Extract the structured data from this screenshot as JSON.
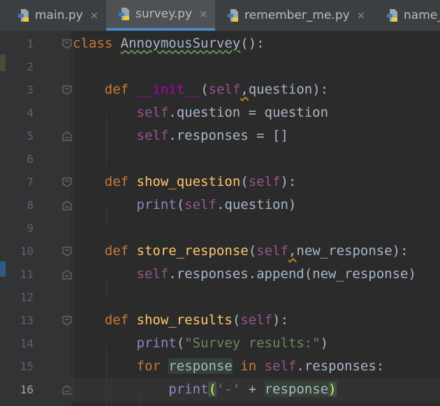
{
  "tabs": [
    {
      "label": "main.py",
      "close": "×",
      "active": false
    },
    {
      "label": "survey.py",
      "close": "×",
      "active": true
    },
    {
      "label": "remember_me.py",
      "close": "×",
      "active": false
    },
    {
      "label": "name_",
      "close": "",
      "active": false
    }
  ],
  "gutter": {
    "line_numbers": [
      "1",
      "2",
      "3",
      "4",
      "5",
      "6",
      "7",
      "8",
      "9",
      "10",
      "11",
      "12",
      "13",
      "14",
      "15",
      "16"
    ],
    "current_line": "16"
  },
  "code": {
    "l1": {
      "kw": "class",
      "name": "AnnoymousSurvey",
      "rest": "():"
    },
    "l3": {
      "kw": "def",
      "name": "__init__",
      "open": "(",
      "self": "self",
      "sep": ",",
      "rest": "question):"
    },
    "l4": {
      "self": "self",
      "rest": ".question = question"
    },
    "l5": {
      "self": "self",
      "rest": ".responses = []"
    },
    "l7": {
      "kw": "def",
      "name": "show_question",
      "open": "(",
      "self": "self",
      "rest": "):"
    },
    "l8": {
      "builtin": "print",
      "open": "(",
      "self": "self",
      "rest": ".question)"
    },
    "l10": {
      "kw": "def",
      "name": "store_response",
      "open": "(",
      "self": "self",
      "sep": ",",
      "rest": "new_response):"
    },
    "l11": {
      "self": "self",
      "rest": ".responses.append(new_response)"
    },
    "l13": {
      "kw": "def",
      "name": "show_results",
      "open": "(",
      "self": "self",
      "rest": "):"
    },
    "l14": {
      "builtin": "print",
      "open": "(",
      "str": "\"Survey results:\"",
      "rest": ")"
    },
    "l15": {
      "kw": "for",
      "var": "response",
      "kw2": "in",
      "self": "self",
      "rest": ".responses:"
    },
    "l16": {
      "builtin": "print",
      "open": "(",
      "str": "'-'",
      "op": " + ",
      "var": "response",
      "close": ")"
    }
  },
  "colors": {
    "background": "#2b2b2b",
    "keyword": "#cc7832",
    "function": "#ffc66d",
    "magic_method": "#b200b2",
    "self": "#94558d",
    "string": "#6a8759",
    "builtin": "#8888c6",
    "text": "#a9b7c6",
    "active_tab_underline": "#4a88c7"
  },
  "icons": {
    "tab_file": "python-file-icon",
    "fold": "fold-marker-icon",
    "intention": "lightbulb-icon"
  }
}
